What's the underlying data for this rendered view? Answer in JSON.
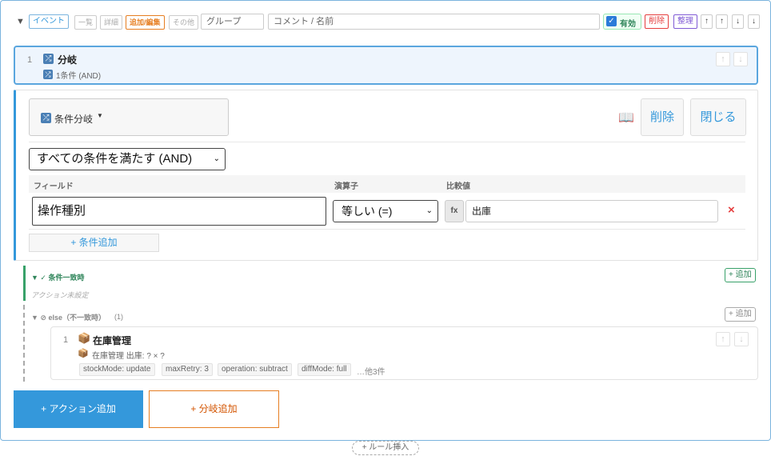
{
  "header": {
    "event_label": "イベント",
    "tabs": [
      "一覧",
      "詳細",
      "追加/編集",
      "その他"
    ],
    "group_placeholder": "グループ",
    "comment_placeholder": "コメント / 名前",
    "enabled_label": "有効",
    "delete_label": "削除",
    "organize_label": "整理",
    "arrows": [
      "↑",
      "↑",
      "↓",
      "↓"
    ]
  },
  "rule": {
    "index": "1",
    "title": "分岐",
    "subtitle": "1条件 (AND)"
  },
  "editor": {
    "type_label": "条件分岐",
    "manual_icon": "📖",
    "delete_label": "削除",
    "close_label": "閉じる",
    "mode_selected": "すべての条件を満たす (AND)",
    "columns": {
      "field": "フィールド",
      "operator": "演算子",
      "compare": "比較値"
    },
    "condition": {
      "field": "操作種別",
      "operator": "等しい (=)",
      "fx": "fx",
      "value": "出庫",
      "remove": "×"
    },
    "add_condition_label": "+ 条件追加"
  },
  "match_branch": {
    "title": "▼ ✓ 条件一致時",
    "add_label": "+ 追加",
    "empty_text": "アクション未設定"
  },
  "else_branch": {
    "title": "▼ ⊘ else（不一致時）",
    "count": "(1)",
    "add_label": "+ 追加",
    "action": {
      "index": "1",
      "icon": "📦",
      "title": "在庫管理",
      "subtitle": "在庫管理 出庫: ? × ?",
      "tags": [
        "stockMode: update",
        "maxRetry: 3",
        "operation: subtract",
        "diffMode: full"
      ],
      "more": "…他3件"
    }
  },
  "footer": {
    "add_action_label": "+ アクション追加",
    "add_branch_label": "+ 分岐追加",
    "insert_rule_label": "+ ルール挿入"
  },
  "colors": {
    "primary": "#3498db",
    "orange": "#e67e22",
    "green": "#38a169",
    "red": "#e53e3e",
    "purple": "#805ad5"
  }
}
